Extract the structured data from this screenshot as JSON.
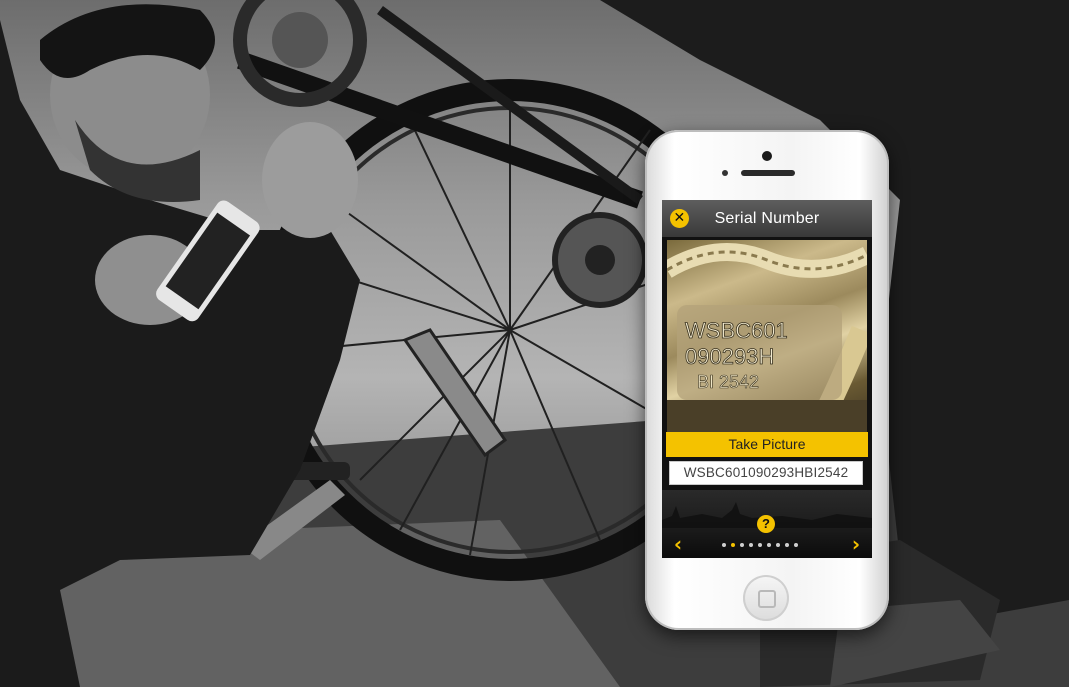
{
  "app": {
    "title": "Serial Number",
    "take_picture_label": "Take Picture",
    "serial_value": "WSBC601090293HBI2542",
    "help_label": "?",
    "close_glyph": "✕",
    "prev_glyph": "‹",
    "next_glyph": "›"
  },
  "photo": {
    "engraving_lines": [
      "WSBC601",
      "090293H",
      "BI 2542"
    ]
  },
  "pager": {
    "total": 9,
    "active_index": 1
  },
  "icons": {
    "close": "close-icon",
    "help": "help-icon",
    "prev": "chevron-left-icon",
    "next": "chevron-right-icon"
  },
  "colors": {
    "accent": "#f4c200",
    "titlebar": "#4a4a4a",
    "screen_bg": "#111111"
  }
}
